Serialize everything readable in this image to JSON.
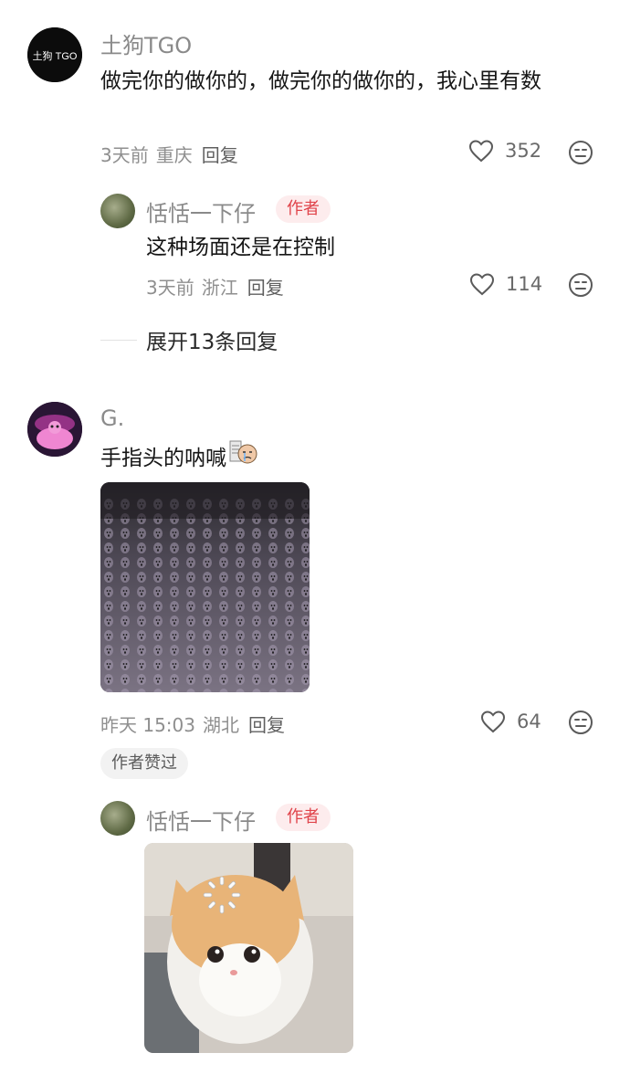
{
  "comments": [
    {
      "user": "土狗TGO",
      "avatar_text": "土狗 TGO",
      "text": "做完你的做你的，做完你的做你的，我心里有数",
      "time": "3天前",
      "location": "重庆",
      "reply_label": "回复",
      "likes": "352",
      "replies": [
        {
          "user": "恬恬一下仔",
          "badge": "作者",
          "text": "这种场面还是在控制",
          "time": "3天前",
          "location": "浙江",
          "reply_label": "回复",
          "likes": "114"
        }
      ],
      "expand_label": "展开13条回复"
    },
    {
      "user": "G.",
      "text": "手指头的呐喊",
      "time": "昨天 15:03",
      "location": "湖北",
      "reply_label": "回复",
      "likes": "64",
      "author_liked_label": "作者赞过",
      "replies": [
        {
          "user": "恬恬一下仔",
          "badge": "作者"
        }
      ]
    }
  ],
  "icons": {
    "like": "heart-outline-icon",
    "more": "neutral-face-icon",
    "emoji": "crying-emoji-sticker"
  },
  "colors": {
    "badge_bg": "#fdeced",
    "badge_text": "#e0434a",
    "meta_text": "#8f8f8f"
  }
}
